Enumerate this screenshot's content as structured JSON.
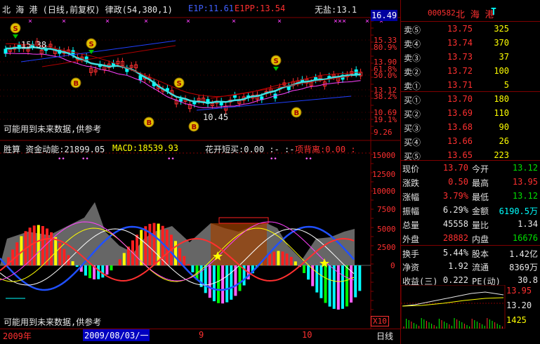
{
  "top_header": {
    "title": "北 海 港 (日线,前复权) 律政(54,380,1)",
    "e1p": "E1P:11.61",
    "e1pp": "E1PP:13.54",
    "wuyan": "无盐:13.1",
    "price_box": "16.49"
  },
  "main_chart": {
    "label_high": "15.38",
    "label_low": "10.45",
    "disclaimer": "可能用到未来数据,供参考",
    "y_labels": [
      "15.33",
      "80.9%",
      "13.90",
      "61.8%",
      "50.0%",
      "13.12",
      "38.2%",
      "10.69",
      "19.1%",
      "9.26"
    ],
    "top_markers": [
      "×",
      "×",
      "×",
      "×",
      "×",
      "×",
      "×",
      "×××",
      "×",
      "×"
    ]
  },
  "indicator": {
    "header_a": "胜算 资金动能:21899.05",
    "header_b": "MACD:18539.93",
    "header_c": "花开短买:0.00 :- :-",
    "header_d": "项背离:0.00 :",
    "y_labels": [
      "15000",
      "12500",
      "10000",
      "7500",
      "5000",
      "2500",
      "0"
    ],
    "disclaimer": "可能用到未来数据,供参考",
    "x10": "X10"
  },
  "bottom_bar": {
    "year": "2009年",
    "date": "2009/08/03/一",
    "m9": "9",
    "m10": "10",
    "period": "日线"
  },
  "quote": {
    "code": "000582",
    "name": "北 海 港",
    "flag": "T",
    "sells": [
      {
        "label": "卖⑤",
        "price": "13.75",
        "vol": "325"
      },
      {
        "label": "卖④",
        "price": "13.74",
        "vol": "370"
      },
      {
        "label": "卖③",
        "price": "13.73",
        "vol": "37"
      },
      {
        "label": "卖②",
        "price": "13.72",
        "vol": "100"
      },
      {
        "label": "卖①",
        "price": "13.71",
        "vol": "5"
      }
    ],
    "buys": [
      {
        "label": "买①",
        "price": "13.70",
        "vol": "180"
      },
      {
        "label": "买②",
        "price": "13.69",
        "vol": "110"
      },
      {
        "label": "买③",
        "price": "13.68",
        "vol": "90"
      },
      {
        "label": "买④",
        "price": "13.66",
        "vol": "26"
      },
      {
        "label": "买⑤",
        "price": "13.65",
        "vol": "223"
      }
    ],
    "stats": [
      {
        "l1": "现价",
        "v1": "13.70",
        "c1": "red",
        "l2": "今开",
        "v2": "13.12",
        "c2": "green"
      },
      {
        "l1": "涨跌",
        "v1": "0.50",
        "c1": "red",
        "l2": "最高",
        "v2": "13.95",
        "c2": "red"
      },
      {
        "l1": "涨幅",
        "v1": "3.79%",
        "c1": "red",
        "l2": "最低",
        "v2": "13.12",
        "c2": "green"
      },
      {
        "l1": "振幅",
        "v1": "6.29%",
        "c1": "white",
        "l2": "金额",
        "v2": "6190.5万",
        "c2": "cyan"
      },
      {
        "l1": "总量",
        "v1": "45558",
        "c1": "white",
        "l2": "量比",
        "v2": "1.34",
        "c2": "white"
      },
      {
        "l1": "外盘",
        "v1": "28882",
        "c1": "red",
        "l2": "内盘",
        "v2": "16676",
        "c2": "green"
      },
      {
        "l1": "换手",
        "v1": "5.44%",
        "c1": "white",
        "l2": "股本",
        "v2": "1.42亿",
        "c2": "white"
      },
      {
        "l1": "净资",
        "v1": "1.92",
        "c1": "white",
        "l2": "流通",
        "v2": "8369万",
        "c2": "white"
      },
      {
        "l1": "收益(三)",
        "v1": "0.222",
        "c1": "white",
        "l2": "PE(动)",
        "v2": "30.8",
        "c2": "white"
      }
    ],
    "mini_high": "13.95",
    "mini_mid": "13.20",
    "mini_vol": "1425"
  },
  "colors": {
    "up": "#ff3030",
    "down": "#00ffff",
    "frame": "#800000",
    "ma_cyan": "#40e0e0",
    "ma_blue": "#2040ff"
  }
}
